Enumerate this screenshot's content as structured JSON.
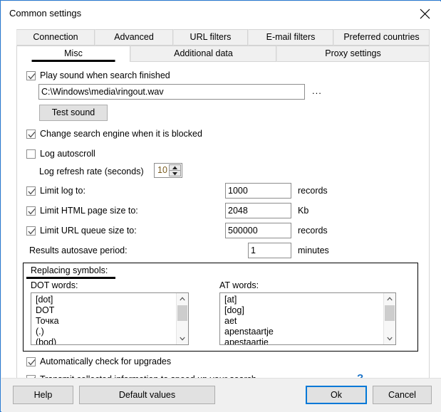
{
  "window": {
    "title": "Common settings",
    "close_icon": "close-icon"
  },
  "tabs": {
    "row1": [
      {
        "label": "Connection",
        "active": false
      },
      {
        "label": "Advanced",
        "active": false
      },
      {
        "label": "URL filters",
        "active": false
      },
      {
        "label": "E-mail filters",
        "active": false
      },
      {
        "label": "Preferred countries",
        "active": false
      }
    ],
    "row2": [
      {
        "label": "Misc",
        "active": true
      },
      {
        "label": "Additional data",
        "active": false
      },
      {
        "label": "Proxy settings",
        "active": false
      }
    ]
  },
  "misc": {
    "play_sound": {
      "label": "Play sound when search finished",
      "checked": true
    },
    "sound_path": {
      "value": "C:\\Windows\\media\\ringout.wav",
      "browse_label": "..."
    },
    "test_sound_label": "Test sound",
    "change_engine": {
      "label": "Change search engine when it is blocked",
      "checked": true
    },
    "log_autoscroll": {
      "label": "Log autoscroll",
      "checked": false
    },
    "log_refresh": {
      "label": "Log refresh rate (seconds)",
      "value": "10"
    },
    "limit_log": {
      "label": "Limit log to:",
      "checked": true,
      "value": "1000",
      "unit": "records"
    },
    "limit_html": {
      "label": "Limit HTML page size to:",
      "checked": true,
      "value": "2048",
      "unit": "Kb"
    },
    "limit_queue": {
      "label": "Limit URL queue size to:",
      "checked": true,
      "value": "500000",
      "unit": "records"
    },
    "autosave": {
      "label": "Results autosave period:",
      "value": "1",
      "unit": "minutes"
    },
    "replacing_symbols": {
      "title": "Replacing symbols:",
      "dot_words": {
        "label": "DOT words:",
        "items": [
          "[dot]",
          "DOT",
          "Точка",
          "(.)",
          "(bod)"
        ]
      },
      "at_words": {
        "label": "AT words:",
        "items": [
          "[at]",
          "[dog]",
          "aet",
          "apenstaartje",
          "apestaartje"
        ]
      }
    },
    "auto_upgrades": {
      "label": "Automatically check for upgrades",
      "checked": true
    },
    "transmit_info": {
      "label": "Transmit collected information to speed up your search",
      "checked": true
    },
    "help_mark": "?"
  },
  "buttons": {
    "help": "Help",
    "default_values": "Default values",
    "ok": "Ok",
    "cancel": "Cancel"
  },
  "colors": {
    "accent": "#0078d7",
    "window_border": "#2b7cd3",
    "help_link": "#1a73c8",
    "spinner_text": "#7a5c1e"
  }
}
